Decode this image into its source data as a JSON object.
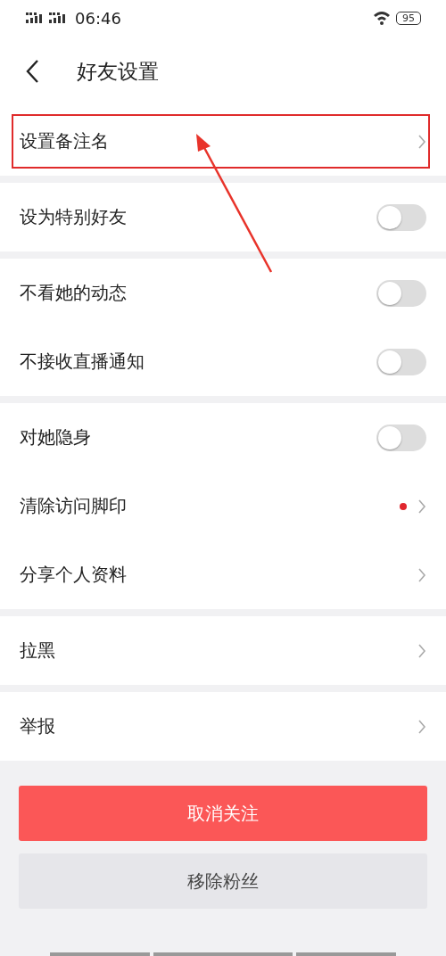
{
  "status_bar": {
    "time": "06:46",
    "battery": "95"
  },
  "header": {
    "title": "好友设置"
  },
  "groups": [
    [
      {
        "kind": "link",
        "label": "设置备注名",
        "highlighted": true,
        "dot": false
      }
    ],
    [
      {
        "kind": "toggle",
        "label": "设为特别好友",
        "on": false
      }
    ],
    [
      {
        "kind": "toggle",
        "label": "不看她的动态",
        "on": false
      },
      {
        "kind": "toggle",
        "label": "不接收直播通知",
        "on": false
      }
    ],
    [
      {
        "kind": "toggle",
        "label": "对她隐身",
        "on": false
      },
      {
        "kind": "link",
        "label": "清除访问脚印",
        "highlighted": false,
        "dot": true
      },
      {
        "kind": "link",
        "label": "分享个人资料",
        "highlighted": false,
        "dot": false
      }
    ],
    [
      {
        "kind": "link",
        "label": "拉黑",
        "highlighted": false,
        "dot": false
      }
    ],
    [
      {
        "kind": "link",
        "label": "举报",
        "highlighted": false,
        "dot": false
      }
    ]
  ],
  "buttons": [
    {
      "kind": "primary",
      "label": "取消关注"
    },
    {
      "kind": "secondary",
      "label": "移除粉丝"
    }
  ]
}
